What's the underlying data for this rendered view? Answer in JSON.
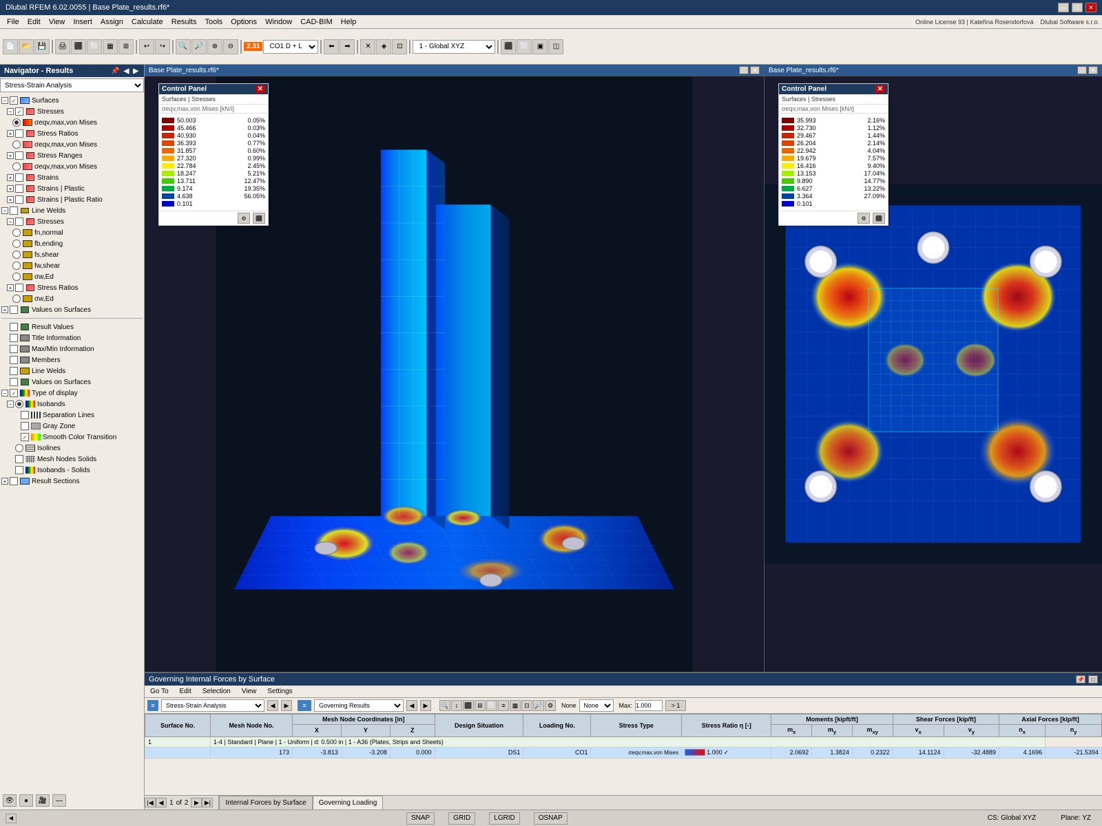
{
  "title_bar": {
    "title": "Dlubal RFEM 6.02.0055 | Base Plate_results.rf6*",
    "controls": [
      "—",
      "□",
      "✕"
    ]
  },
  "menu": {
    "items": [
      "File",
      "Edit",
      "View",
      "Insert",
      "Assign",
      "Calculate",
      "Results",
      "Tools",
      "Options",
      "Window",
      "CAD-BIM",
      "Help"
    ]
  },
  "toolbar": {
    "combo1": "2.31",
    "combo1_suffix": "CO1  D + L",
    "combo2": "1 - Global XYZ"
  },
  "navigator": {
    "title": "Navigator - Results",
    "dropdown": "Stress-Strain Analysis",
    "tree": [
      {
        "label": "Surfaces",
        "level": 1,
        "type": "check",
        "checked": true,
        "expanded": true
      },
      {
        "label": "Stresses",
        "level": 2,
        "type": "check",
        "checked": true,
        "expanded": true
      },
      {
        "label": "σeqv,max,von Mises",
        "level": 3,
        "type": "radio",
        "selected": true
      },
      {
        "label": "Stress Ratios",
        "level": 2,
        "type": "check",
        "checked": false,
        "expanded": true
      },
      {
        "label": "σeqv,max,von Mises",
        "level": 3,
        "type": "radio",
        "selected": false
      },
      {
        "label": "Stress Ranges",
        "level": 2,
        "type": "check",
        "checked": false,
        "expanded": true
      },
      {
        "label": "σeqv,max,von Mises",
        "level": 3,
        "type": "radio",
        "selected": false
      },
      {
        "label": "Strains",
        "level": 2,
        "type": "check",
        "checked": false,
        "expanded": false
      },
      {
        "label": "Strains | Plastic",
        "level": 2,
        "type": "check",
        "checked": false,
        "expanded": false
      },
      {
        "label": "Strains | Plastic Ratio",
        "level": 2,
        "type": "check",
        "checked": false,
        "expanded": false
      },
      {
        "label": "Line Welds",
        "level": 1,
        "type": "check",
        "checked": false,
        "expanded": true
      },
      {
        "label": "Stresses",
        "level": 2,
        "type": "check",
        "checked": false,
        "expanded": true
      },
      {
        "label": "fn,normal",
        "level": 3,
        "type": "radio",
        "selected": false
      },
      {
        "label": "fb,ending",
        "level": 3,
        "type": "radio",
        "selected": false
      },
      {
        "label": "fs,shear",
        "level": 3,
        "type": "radio",
        "selected": false
      },
      {
        "label": "fw,shear",
        "level": 3,
        "type": "radio",
        "selected": false
      },
      {
        "label": "σw,Ed",
        "level": 3,
        "type": "radio",
        "selected": false
      },
      {
        "label": "Stress Ratios",
        "level": 2,
        "type": "check",
        "checked": false,
        "expanded": false
      },
      {
        "label": "σw,Ed",
        "level": 3,
        "type": "radio",
        "selected": false
      },
      {
        "label": "Values on Surfaces",
        "level": 1,
        "type": "check",
        "checked": false,
        "expanded": false
      }
    ],
    "bottom_items": [
      {
        "label": "Result Values",
        "level": 1,
        "type": "check",
        "checked": false
      },
      {
        "label": "Title Information",
        "level": 1,
        "type": "check",
        "checked": false
      },
      {
        "label": "Max/Min Information",
        "level": 1,
        "type": "check",
        "checked": false
      },
      {
        "label": "Members",
        "level": 1,
        "type": "check",
        "checked": false
      },
      {
        "label": "Line Welds",
        "level": 1,
        "type": "check",
        "checked": false
      },
      {
        "label": "Values on Surfaces",
        "level": 1,
        "type": "check",
        "checked": false
      },
      {
        "label": "Type of display",
        "level": 1,
        "type": "check",
        "checked": true,
        "expanded": true
      },
      {
        "label": "Isobands",
        "level": 2,
        "type": "radio",
        "selected": true,
        "expanded": true
      },
      {
        "label": "Separation Lines",
        "level": 3,
        "type": "check",
        "checked": false
      },
      {
        "label": "Gray Zone",
        "level": 3,
        "type": "check",
        "checked": false
      },
      {
        "label": "Smooth Color Transition",
        "level": 3,
        "type": "check",
        "checked": true
      },
      {
        "label": "Isolines",
        "level": 2,
        "type": "radio",
        "selected": false
      },
      {
        "label": "Mesh Nodes Solids",
        "level": 2,
        "type": "check",
        "checked": false
      },
      {
        "label": "Isobands - Solids",
        "level": 2,
        "type": "check",
        "checked": false
      },
      {
        "label": "Result Sections",
        "level": 1,
        "type": "check",
        "checked": false
      }
    ]
  },
  "left_viewport": {
    "title": "Base Plate_results.rf6*",
    "control_panel": {
      "title": "Control Panel",
      "subtitle": "Surfaces | Stresses",
      "subtitle2": "σeqv,max,von Mises [kN/i]",
      "legend": [
        {
          "value": "50.003",
          "pct": "0.05%",
          "color": "#800000"
        },
        {
          "value": "45.466",
          "pct": "0.03%",
          "color": "#aa0000"
        },
        {
          "value": "40.930",
          "pct": "0.04%",
          "color": "#cc2200"
        },
        {
          "value": "36.393",
          "pct": "0.77%",
          "color": "#dd4400"
        },
        {
          "value": "31.857",
          "pct": "0.60%",
          "color": "#ee6600"
        },
        {
          "value": "27.320",
          "pct": "0.99%",
          "color": "#ffaa00"
        },
        {
          "value": "22.784",
          "pct": "2.45%",
          "color": "#ffee00"
        },
        {
          "value": "18.247",
          "pct": "5.21%",
          "color": "#aaee00"
        },
        {
          "value": "13.711",
          "pct": "12.47%",
          "color": "#44cc00"
        },
        {
          "value": "9.174",
          "pct": "19.35%",
          "color": "#00aa44"
        },
        {
          "value": "4.638",
          "pct": "56.05%",
          "color": "#0044aa"
        },
        {
          "value": "0.101",
          "pct": "",
          "color": "#0000cc"
        }
      ]
    }
  },
  "right_viewport": {
    "title": "Base Plate_results.rf6*",
    "control_panel": {
      "title": "Control Panel",
      "subtitle": "Surfaces | Stresses",
      "subtitle2": "σeqv,max,von Mises [kN/i]",
      "legend": [
        {
          "value": "35.993",
          "pct": "2.16%",
          "color": "#800000"
        },
        {
          "value": "32.730",
          "pct": "1.12%",
          "color": "#aa0000"
        },
        {
          "value": "29.467",
          "pct": "1.44%",
          "color": "#cc2200"
        },
        {
          "value": "26.204",
          "pct": "2.14%",
          "color": "#dd4400"
        },
        {
          "value": "22.942",
          "pct": "4.04%",
          "color": "#ee6600"
        },
        {
          "value": "19.679",
          "pct": "7.57%",
          "color": "#ffaa00"
        },
        {
          "value": "16.416",
          "pct": "9.40%",
          "color": "#ffee00"
        },
        {
          "value": "13.153",
          "pct": "17.04%",
          "color": "#aaee00"
        },
        {
          "value": "9.890",
          "pct": "14.77%",
          "color": "#44cc00"
        },
        {
          "value": "6.627",
          "pct": "13.22%",
          "color": "#00aa44"
        },
        {
          "value": "3.364",
          "pct": "27.09%",
          "color": "#0044aa"
        },
        {
          "value": "0.101",
          "pct": "",
          "color": "#0000cc"
        }
      ]
    }
  },
  "results_panel": {
    "title": "Governing Internal Forces by Surface",
    "menu_items": [
      "Go To",
      "Edit",
      "Selection",
      "View",
      "Settings"
    ],
    "analysis_combo": "Stress-Strain Analysis",
    "results_combo": "Governing Results",
    "table_headers": [
      "Surface No.",
      "Mesh Node No.",
      "Mesh Node Coordinates [in]",
      "",
      "",
      "Design Situation",
      "Loading No.",
      "Stress Type",
      "Stress Ratio η [-]",
      "Moments [kipft/ft]",
      "",
      "",
      "Shear Forces [kip/ft]",
      "",
      "Axial Forces [kip/ft]",
      ""
    ],
    "sub_headers": [
      "",
      "",
      "X",
      "Y",
      "Z",
      "",
      "",
      "",
      "",
      "mx",
      "my",
      "mxy",
      "vx",
      "vy",
      "nx",
      "ny"
    ],
    "rows": [
      {
        "surface": "1",
        "mesh_nodes": "1-4 | Standard | Plane | 1 - Uniform | d: 0.500 in | 1 - A36 (Plates, Strips and Sheets)",
        "info_row": true
      },
      {
        "surface": "",
        "mesh_node": "173",
        "x": "-3.813",
        "y": "-3.208",
        "z": "0.000",
        "design": "DS1",
        "loading": "CO1",
        "stress_type": "σeqv,max,von Mises",
        "ratio": "1.000",
        "mx": "2.0692",
        "my": "1.3824",
        "mxy": "0.2322",
        "vx": "14.1124",
        "vy": "-32.4889",
        "nx": "4.1696",
        "ny": "-21.5394",
        "selected": true
      }
    ],
    "page_nav": {
      "current": "1",
      "total": "2",
      "label": "of"
    },
    "tabs": [
      "Internal Forces by Surface",
      "Governing Loading"
    ]
  },
  "status_bar": {
    "items": [
      "SNAP",
      "GRID",
      "LGRID",
      "OSNAP"
    ],
    "cs": "CS: Global XYZ",
    "plane": "Plane: YZ"
  }
}
